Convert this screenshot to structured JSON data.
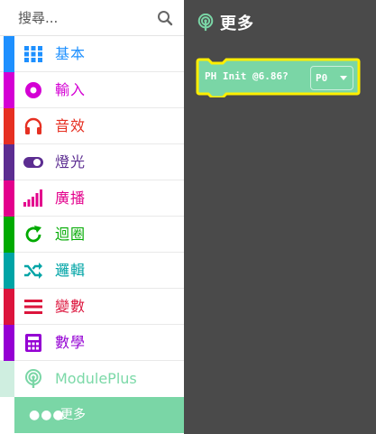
{
  "search": {
    "placeholder": "搜尋..."
  },
  "categories": [
    {
      "label": "基本",
      "color": "#1e90ff",
      "icon": "grid-icon"
    },
    {
      "label": "輸入",
      "color": "#d400d4",
      "icon": "input-circle-icon"
    },
    {
      "label": "音效",
      "color": "#e63022",
      "icon": "headphones-icon"
    },
    {
      "label": "燈光",
      "color": "#5c2d91",
      "icon": "toggle-icon"
    },
    {
      "label": "廣播",
      "color": "#e3008c",
      "icon": "signal-bars-icon"
    },
    {
      "label": "迴圈",
      "color": "#00aa00",
      "icon": "loop-arrow-icon"
    },
    {
      "label": "邏輯",
      "color": "#00a4a6",
      "icon": "shuffle-icon"
    },
    {
      "label": "變數",
      "color": "#dc143c",
      "icon": "list-lines-icon"
    },
    {
      "label": "數學",
      "color": "#9400d3",
      "icon": "calculator-icon"
    }
  ],
  "moduleplus": {
    "label": "ModulePlus",
    "color": "#7ad6a6",
    "icon": "radio-tower-icon"
  },
  "more": {
    "label": "更多",
    "icon": "dots-icon",
    "dots": "●●●"
  },
  "flyout": {
    "title": "更多",
    "background": "#4a4a4a",
    "block": {
      "text": "PH Init @6.86?",
      "dropdown": "P0",
      "color": "#7ad6a6",
      "outline": "#ffee00"
    }
  }
}
